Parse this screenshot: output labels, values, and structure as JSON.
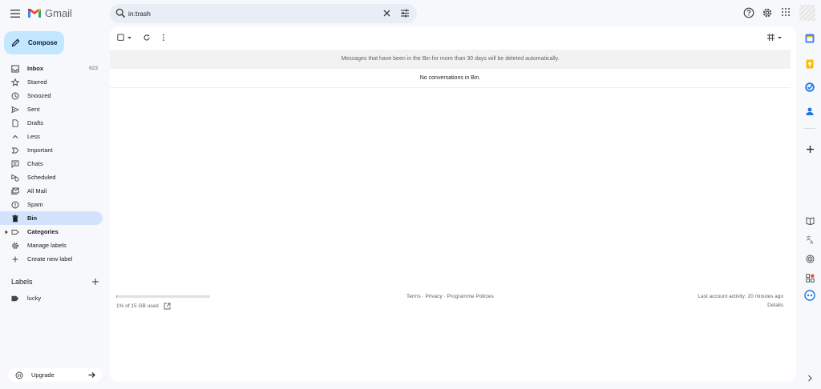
{
  "app": {
    "name": "Gmail"
  },
  "search": {
    "value": "in:trash"
  },
  "compose": {
    "label": "Compose"
  },
  "nav": {
    "items": [
      {
        "label": "Inbox",
        "count": "623"
      },
      {
        "label": "Starred"
      },
      {
        "label": "Snoozed"
      },
      {
        "label": "Sent"
      },
      {
        "label": "Drafts"
      },
      {
        "label": "Less"
      },
      {
        "label": "Important"
      },
      {
        "label": "Chats"
      },
      {
        "label": "Scheduled"
      },
      {
        "label": "All Mail"
      },
      {
        "label": "Spam"
      },
      {
        "label": "Bin"
      },
      {
        "label": "Categories"
      },
      {
        "label": "Manage labels"
      },
      {
        "label": "Create new label"
      }
    ]
  },
  "labels": {
    "title": "Labels",
    "items": [
      {
        "label": "lucky"
      }
    ]
  },
  "upgrade": {
    "label": "Upgrade"
  },
  "main": {
    "notice": "Messages that have been in the Bin for more than 30 days will be deleted automatically.",
    "empty": "No conversations in Bin."
  },
  "footer": {
    "storage": "1% of 15 GB used",
    "storage_fraction": 0.01,
    "links": "Terms · Privacy · Programme Policies",
    "activity": "Last account activity: 20 minutes ago",
    "details": "Details"
  },
  "colors": {
    "accent": "#c2e7ff",
    "active_nav": "#d3e3fd",
    "background": "#f6f8fc"
  }
}
